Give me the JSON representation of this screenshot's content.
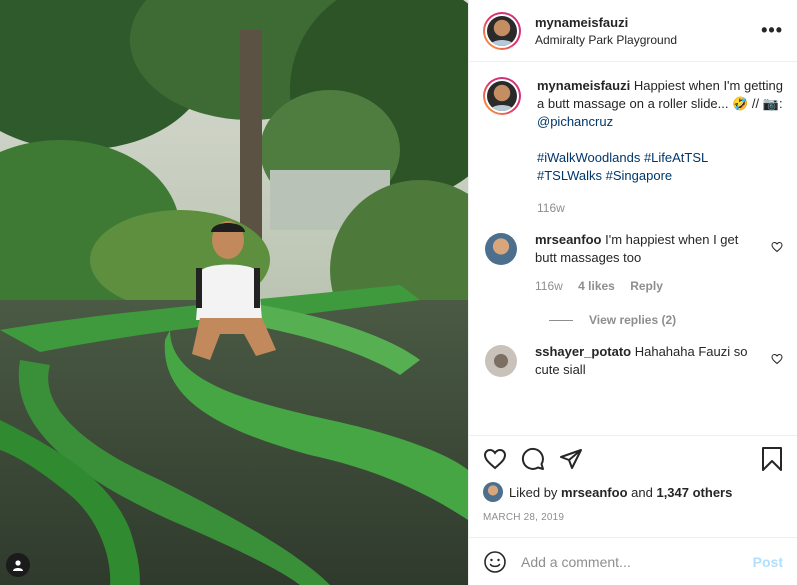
{
  "post": {
    "username": "mynameisfauzi",
    "location": "Admiralty Park Playground",
    "more_icon": "more-horizontal-icon"
  },
  "caption": {
    "username": "mynameisfauzi",
    "text": "Happiest when I'm getting a butt massage on a roller slide...",
    "emoji": "🤣 // 📷:",
    "mention": "@pichancruz",
    "hashtags_line1": "#iWalkWoodlands #LifeAtTSL",
    "hashtags_line2": "#TSLWalks #Singapore",
    "time": "116w"
  },
  "comments": [
    {
      "username": "mrseanfoo",
      "text": "I'm happiest when I get butt massages too",
      "time": "116w",
      "likes": "4 likes",
      "reply": "Reply",
      "view_replies": "View replies (2)"
    },
    {
      "username": "sshayer_potato",
      "text": "Hahahaha Fauzi so cute siall"
    }
  ],
  "likes": {
    "prefix": "Liked by",
    "user": "mrseanfoo",
    "joiner": "and",
    "others": "1,347 others"
  },
  "date": "MARCH 28, 2019",
  "add_comment": {
    "placeholder": "Add a comment...",
    "post_label": "Post"
  },
  "colors": {
    "link": "#00376b",
    "muted": "#8e8e8e",
    "post_disabled": "#b2dffc"
  }
}
